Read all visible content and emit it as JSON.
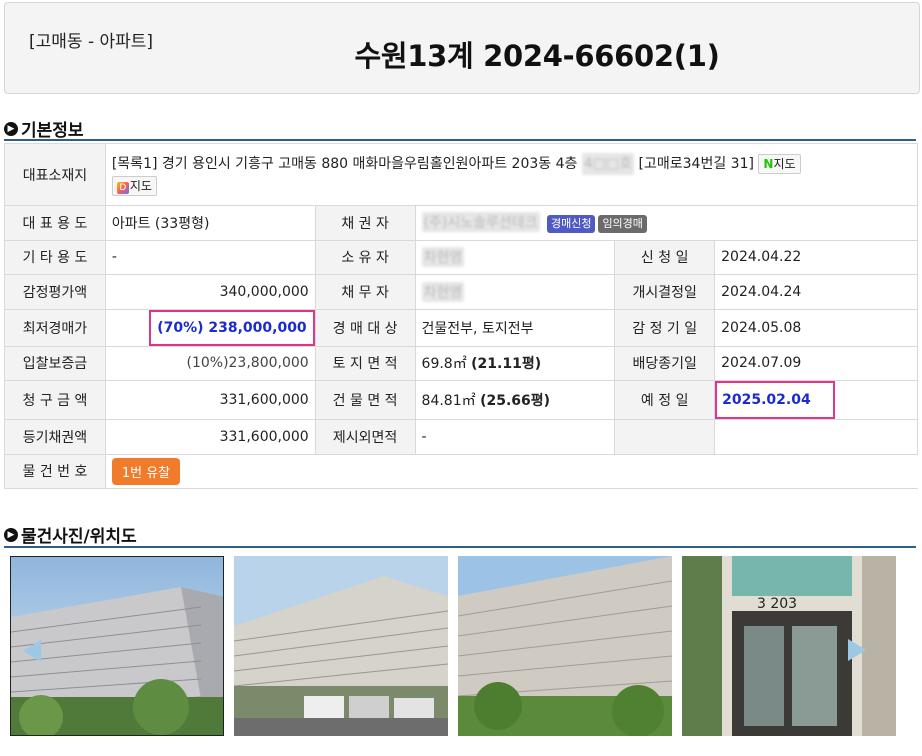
{
  "header": {
    "region": "[고매동 - 아파트]",
    "case_number": "수원13계 2024-66602(1)"
  },
  "sections": {
    "basic_info": "기본정보",
    "photos": "물건사진/위치도"
  },
  "address": {
    "label": "대표소재지",
    "text": "[목록1] 경기 용인시 기흥구 고매동 880 매화마을우림홀인원아파트 203동 4층",
    "masked": "4□□호",
    "road": "[고매로34번길 31]",
    "naver_map": "지도",
    "daum_map": "지도"
  },
  "rows": {
    "usage_label": "대 표 용 도",
    "usage_value": "아파트 (33평형)",
    "creditor_label": "채 권 자",
    "creditor_masked": "(주)시노솔루션테크",
    "badge_auction": "경매신청",
    "badge_voluntary": "임의경매",
    "other_label": "기 타 용 도",
    "other_value": "-",
    "owner_label": "소 유 자",
    "owner_masked": "차현영",
    "apply_label": "신 청 일",
    "apply_value": "2024.04.22",
    "appraisal_label": "감정평가액",
    "appraisal_value": "340,000,000",
    "debtor_label": "채 무 자",
    "debtor_masked": "차현영",
    "start_label": "개시결정일",
    "start_value": "2024.04.24",
    "min_label": "최저경매가",
    "min_value": "(70%) 238,000,000",
    "target_label": "경 매 대 상",
    "target_value": "건물전부, 토지전부",
    "appr_date_label": "감 정 기 일",
    "appr_date_value": "2024.05.08",
    "deposit_label": "입찰보증금",
    "deposit_value": "(10%)23,800,000",
    "land_label": "토 지 면 적",
    "land_value": "69.8㎡",
    "land_pyeong": "(21.11평)",
    "dividend_label": "배당종기일",
    "dividend_value": "2024.07.09",
    "claim_label": "청 구 금 액",
    "claim_value": "331,600,000",
    "building_label": "건 물 면 적",
    "building_value": "84.81㎡",
    "building_pyeong": "(25.66평)",
    "scheduled_label": "예 정 일",
    "scheduled_value": "2025.02.04",
    "registered_label": "등기채권액",
    "registered_value": "331,600,000",
    "excluded_label": "제시외면적",
    "excluded_value": "-",
    "item_label": "물 건 번 호",
    "item_button": "1번 유찰"
  },
  "colors": {
    "accent_pink": "#e0338f",
    "accent_blue": "#1a2bd1",
    "orange": "#f07b2a",
    "section_line": "#2f5f87"
  }
}
